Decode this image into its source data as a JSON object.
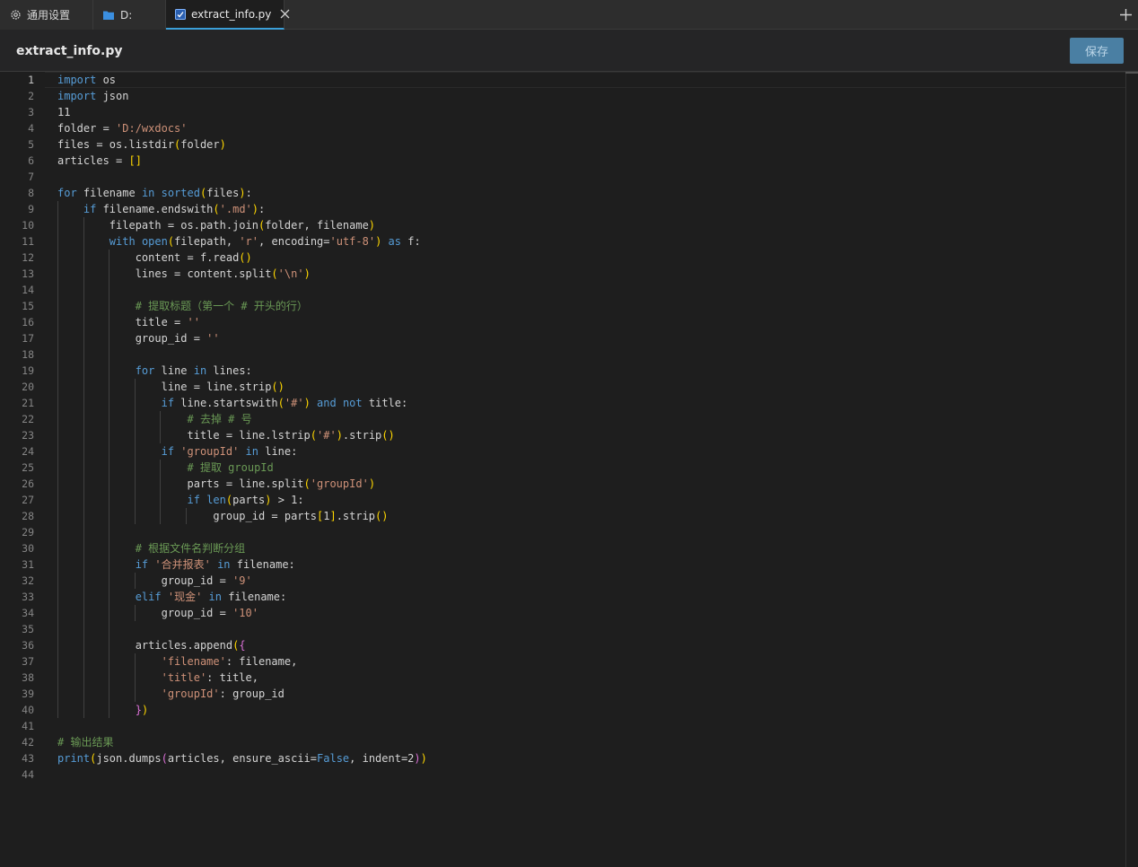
{
  "tabs": [
    {
      "label": "通用设置",
      "icon": "gear-icon"
    },
    {
      "label": "D:",
      "icon": "folder-icon"
    },
    {
      "label": "extract_info.py",
      "icon": "python-file-icon",
      "active": true
    }
  ],
  "file": {
    "name": "extract_info.py"
  },
  "toolbar": {
    "save_label": "保存"
  },
  "editor": {
    "current_line": 1,
    "lines": [
      "import os",
      "import json",
      "11",
      "folder = 'D:/wxdocs'",
      "files = os.listdir(folder)",
      "articles = []",
      "",
      "for filename in sorted(files):",
      "    if filename.endswith('.md'):",
      "        filepath = os.path.join(folder, filename)",
      "        with open(filepath, 'r', encoding='utf-8') as f:",
      "            content = f.read()",
      "            lines = content.split('\\n')",
      "",
      "            # 提取标题（第一个 # 开头的行）",
      "            title = ''",
      "            group_id = ''",
      "",
      "            for line in lines:",
      "                line = line.strip()",
      "                if line.startswith('#') and not title:",
      "                    # 去掉 # 号",
      "                    title = line.lstrip('#').strip()",
      "                if 'groupId' in line:",
      "                    # 提取 groupId",
      "                    parts = line.split('groupId')",
      "                    if len(parts) > 1:",
      "                        group_id = parts[1].strip()",
      "",
      "            # 根据文件名判断分组",
      "            if '合并报表' in filename:",
      "                group_id = '9'",
      "            elif '现金' in filename:",
      "                group_id = '10'",
      "",
      "            articles.append({",
      "                'filename': filename,",
      "                'title': title,",
      "                'groupId': group_id",
      "            })",
      "",
      "# 输出结果",
      "print(json.dumps(articles, ensure_ascii=False, indent=2))",
      ""
    ]
  },
  "colors": {
    "background": "#1e1e1e",
    "keyword": "#569cd6",
    "string": "#ce9178",
    "comment": "#6a9955",
    "accent": "#3b9fd8",
    "save_button": "#4a7fa3"
  }
}
